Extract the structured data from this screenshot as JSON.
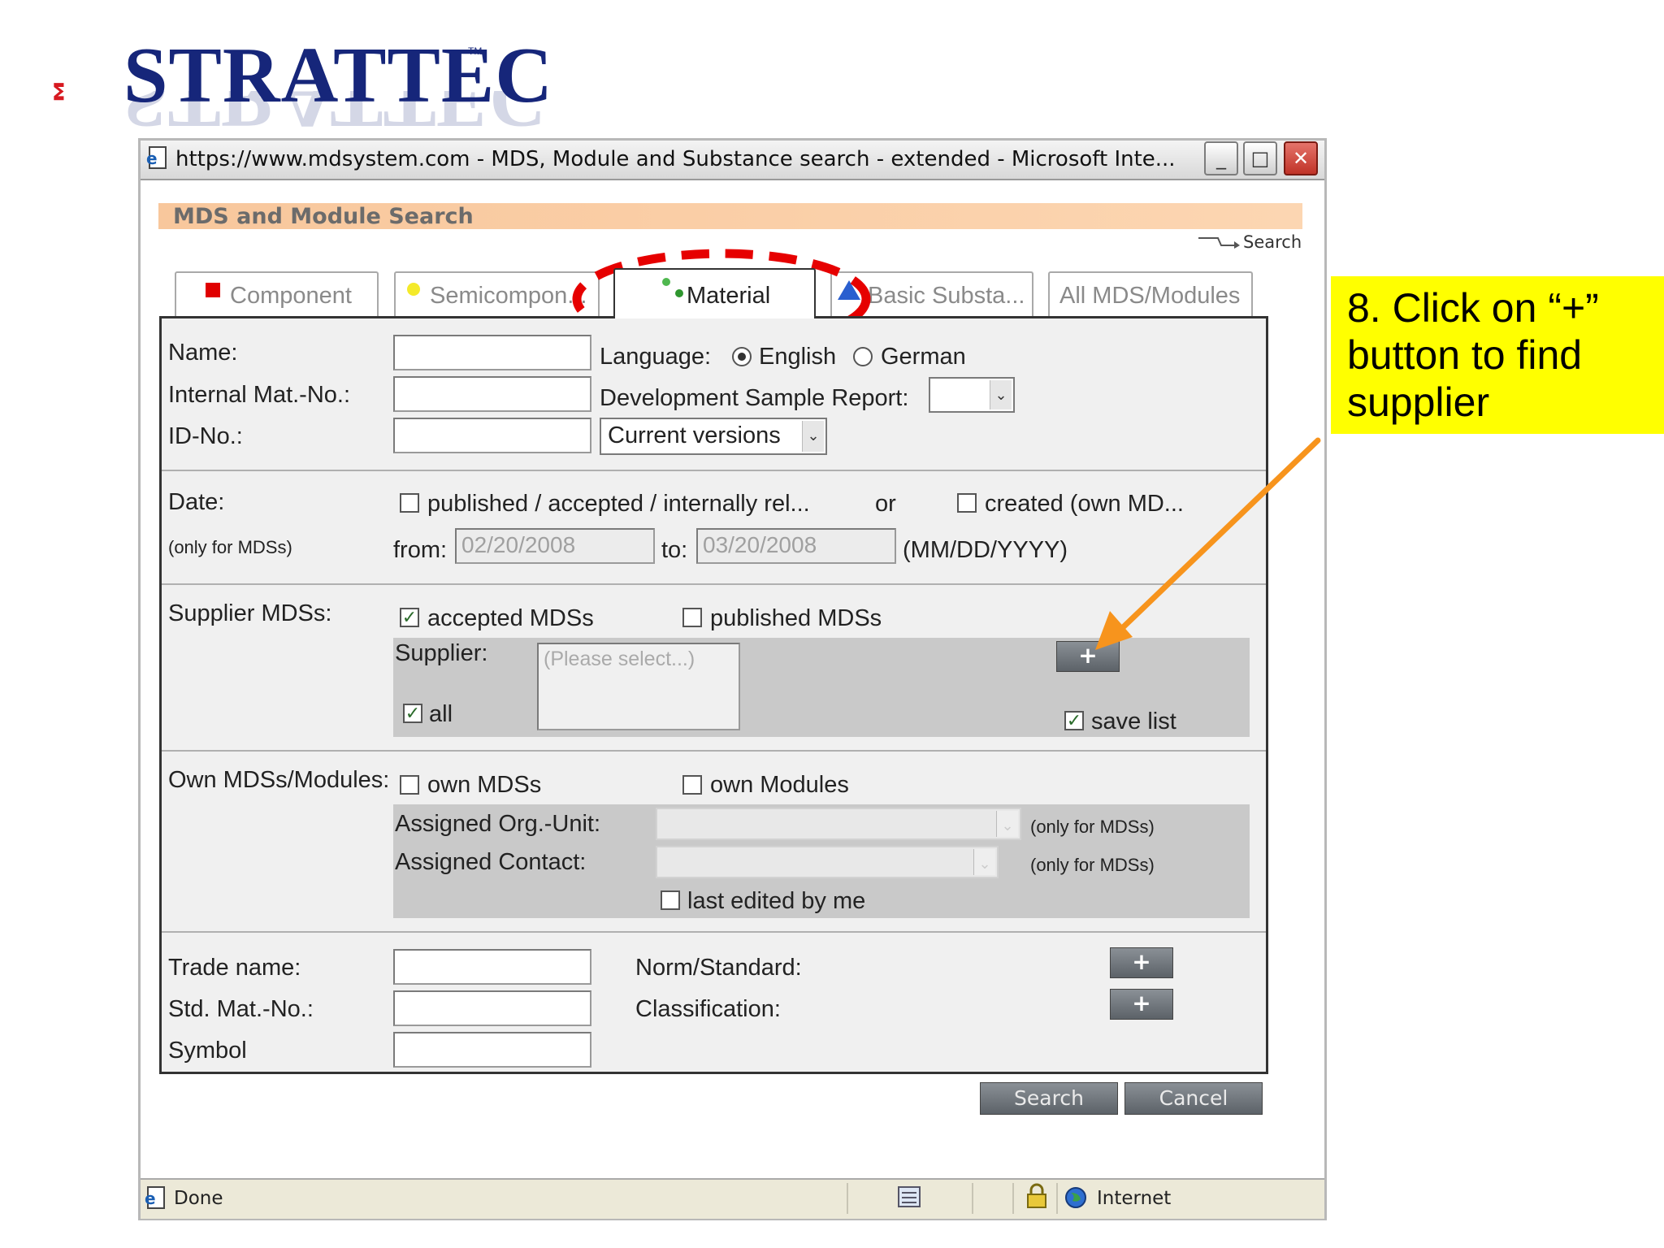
{
  "logo": {
    "text": "STRATTEC",
    "tm": "TM"
  },
  "window": {
    "title": "https://www.mdsystem.com - MDS, Module and Substance search - extended - Microsoft Inte..."
  },
  "header": {
    "title": "MDS and Module Search",
    "search_link": "Search"
  },
  "tabs": [
    {
      "label": "Component",
      "selected": false
    },
    {
      "label": "Semicompon...",
      "selected": false
    },
    {
      "label": "Material",
      "selected": true
    },
    {
      "label": "Basic Substa...",
      "selected": false
    },
    {
      "label": "All MDS/Modules",
      "selected": false
    }
  ],
  "form": {
    "name_label": "Name:",
    "internal_mat_no_label": "Internal Mat.-No.:",
    "id_no_label": "ID-No.:",
    "language_label": "Language:",
    "language_options": [
      "English",
      "German"
    ],
    "language_selected": "English",
    "dev_sample_report_label": "Development Sample Report:",
    "dev_sample_report_value": "",
    "versions_value": "Current versions",
    "date_label": "Date:",
    "date_note": "(only for MDSs)",
    "published_option": "published / accepted / internally rel...",
    "or_text": "or",
    "created_option": "created (own MD...",
    "from_label": "from:",
    "from_value": "02/20/2008",
    "to_label": "to:",
    "to_value": "03/20/2008",
    "date_format": "(MM/DD/YYYY)",
    "supplier_mdss_label": "Supplier MDSs:",
    "accepted_mdss": "accepted MDSs",
    "published_mdss": "published MDSs",
    "supplier_label": "Supplier:",
    "supplier_placeholder": "(Please select...)",
    "all_label": "all",
    "save_list_label": "save list",
    "plus_label": "+",
    "own_label": "Own MDSs/Modules:",
    "own_mdss": "own MDSs",
    "own_modules": "own Modules",
    "assigned_org_label": "Assigned Org.-Unit:",
    "assigned_contact_label": "Assigned Contact:",
    "only_for_mdss": "(only for MDSs)",
    "last_edited": "last edited by me",
    "trade_name_label": "Trade name:",
    "std_mat_no_label": "Std. Mat.-No.:",
    "symbol_label": "Symbol",
    "norm_label": "Norm/Standard:",
    "classification_label": "Classification:",
    "search_button": "Search",
    "cancel_button": "Cancel"
  },
  "checkbox_states": {
    "published": false,
    "created": false,
    "accepted_mdss": true,
    "published_mdss": false,
    "all": true,
    "save_list": true,
    "own_mdss": false,
    "own_modules": false,
    "last_edited": false
  },
  "statusbar": {
    "status": "Done",
    "zone": "Internet"
  },
  "callout": {
    "text": "8. Click on “+” button to find supplier"
  },
  "colors": {
    "header_bar": "#f8c79c",
    "callout": "#ffff00",
    "arrow": "#f7941d",
    "highlight_ellipse": "#e60000",
    "logo_blue": "#16267a",
    "logo_red": "#d71920"
  },
  "icons": [
    "ie-page-icon",
    "minimize-icon",
    "maximize-icon",
    "close-icon",
    "component-red-square-icon",
    "semicomponent-yellow-dot-icon",
    "material-green-dots-icon",
    "basic-substance-blue-triangle-icon",
    "search-arrow-icon",
    "padlock-icon",
    "globe-icon",
    "page-icon"
  ]
}
